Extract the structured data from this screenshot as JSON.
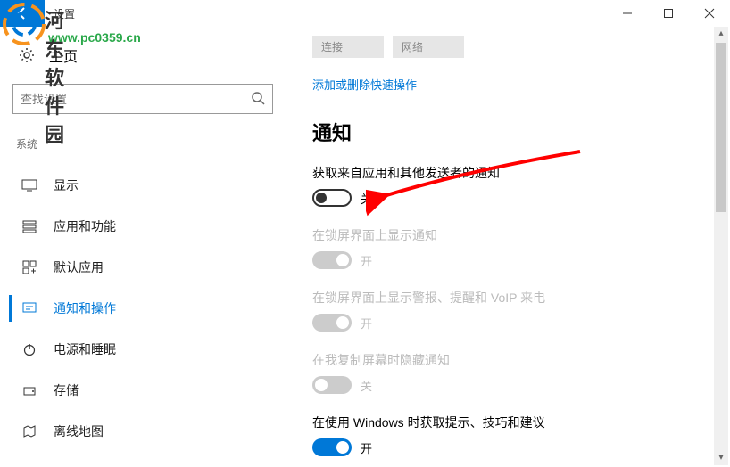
{
  "window": {
    "title": "设置"
  },
  "watermark": {
    "site_name": "河东软件园",
    "url": "www.pc0359.cn"
  },
  "sidebar": {
    "home": "主页",
    "search_placeholder": "查找设置",
    "category": "系统",
    "items": [
      {
        "icon": "display",
        "label": "显示"
      },
      {
        "icon": "apps",
        "label": "应用和功能"
      },
      {
        "icon": "defaults",
        "label": "默认应用"
      },
      {
        "icon": "notify",
        "label": "通知和操作",
        "active": true
      },
      {
        "icon": "power",
        "label": "电源和睡眠"
      },
      {
        "icon": "storage",
        "label": "存储"
      },
      {
        "icon": "map",
        "label": "离线地图"
      }
    ]
  },
  "main": {
    "top_boxes": [
      "连接",
      "网络"
    ],
    "quick_actions_link": "添加或删除快速操作",
    "section_title": "通知",
    "settings": [
      {
        "label": "获取来自应用和其他发送者的通知",
        "state": "关",
        "on": false,
        "disabled": false
      },
      {
        "label": "在锁屏界面上显示通知",
        "state": "开",
        "on": true,
        "disabled": true
      },
      {
        "label": "在锁屏界面上显示警报、提醒和 VoIP 来电",
        "state": "开",
        "on": true,
        "disabled": true
      },
      {
        "label": "在我复制屏幕时隐藏通知",
        "state": "关",
        "on": false,
        "disabled": true
      },
      {
        "label": "在使用 Windows 时获取提示、技巧和建议",
        "state": "开",
        "on": true,
        "disabled": false
      }
    ]
  }
}
